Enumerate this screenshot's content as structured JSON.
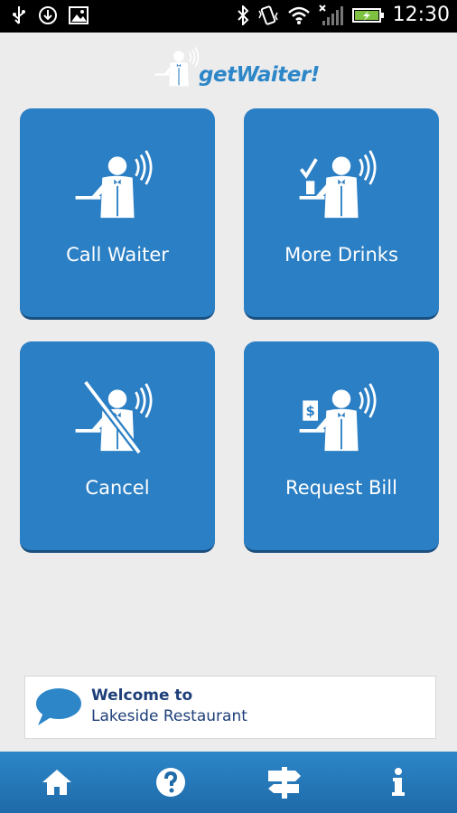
{
  "status_bar": {
    "time": "12:30",
    "icons_left": [
      "usb-icon",
      "download-icon",
      "image-icon"
    ],
    "icons_right": [
      "bluetooth-icon",
      "vibrate-icon",
      "wifi-icon",
      "signal-icon",
      "battery-icon"
    ]
  },
  "app": {
    "logo_text": "getWaiter!"
  },
  "tiles": [
    {
      "label": "Call Waiter",
      "icon": "waiter-icon"
    },
    {
      "label": "More Drinks",
      "icon": "drink-waiter-icon"
    },
    {
      "label": "Cancel",
      "icon": "cancel-waiter-icon"
    },
    {
      "label": "Request Bill",
      "icon": "bill-waiter-icon"
    }
  ],
  "banner": {
    "line1": "Welcome to",
    "line2": "Lakeside Restaurant"
  },
  "bottom_nav": [
    {
      "icon": "home-icon"
    },
    {
      "icon": "help-icon"
    },
    {
      "icon": "signpost-icon"
    },
    {
      "icon": "info-icon"
    }
  ],
  "colors": {
    "tile_bg": "#2b7fc4",
    "nav_bg": "#2c86c8",
    "page_bg": "#ececec",
    "banner_text": "#1e3f7a"
  }
}
